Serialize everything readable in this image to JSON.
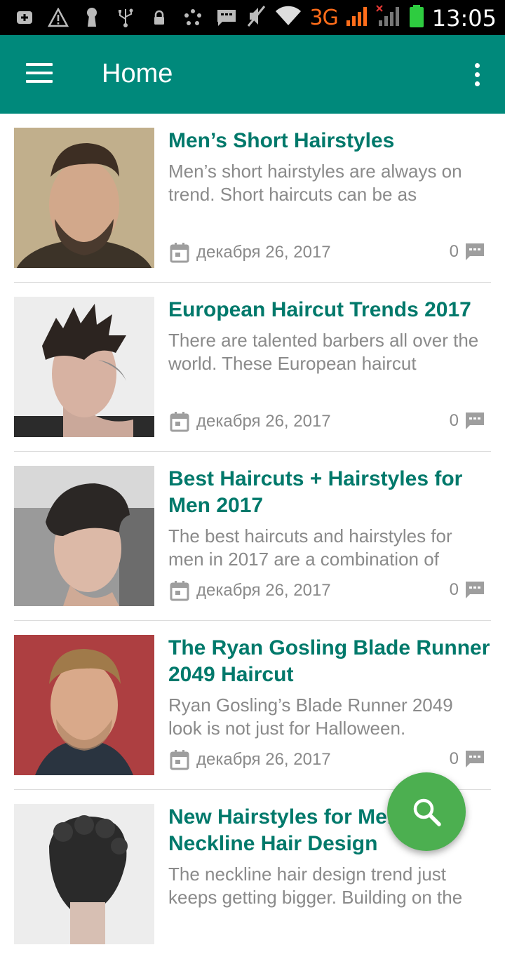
{
  "status_bar": {
    "network": "3G",
    "time": "13:05"
  },
  "app_bar": {
    "title": "Home"
  },
  "posts": [
    {
      "title": "Men’s Short Hairstyles",
      "excerpt": "Men’s short hairstyles are always on trend. Short haircuts can be as",
      "date": "декабря 26, 2017",
      "comments": "0"
    },
    {
      "title": "European Haircut Trends 2017",
      "excerpt": "There are talented barbers all over the world. These European haircut",
      "date": "декабря 26, 2017",
      "comments": "0"
    },
    {
      "title": "Best Haircuts + Hairstyles for Men 2017",
      "excerpt": "The best haircuts and hairstyles for men in 2017 are a combination of",
      "date": "декабря 26, 2017",
      "comments": "0"
    },
    {
      "title": "The Ryan Gosling Blade Runner 2049 Haircut",
      "excerpt": "Ryan Gosling’s Blade Runner 2049 look is not just for Halloween.",
      "date": "декабря 26, 2017",
      "comments": "0"
    },
    {
      "title": "New Hairstyles for Men: Neckline Hair Design",
      "excerpt": "The neckline hair design trend just keeps getting bigger. Building on the",
      "date": "",
      "comments": ""
    }
  ],
  "fab": {
    "icon": "search-icon",
    "color": "#4caf50"
  },
  "colors": {
    "primary": "#00897b",
    "title_text": "#00796b",
    "secondary_text": "#8a8a8a"
  }
}
